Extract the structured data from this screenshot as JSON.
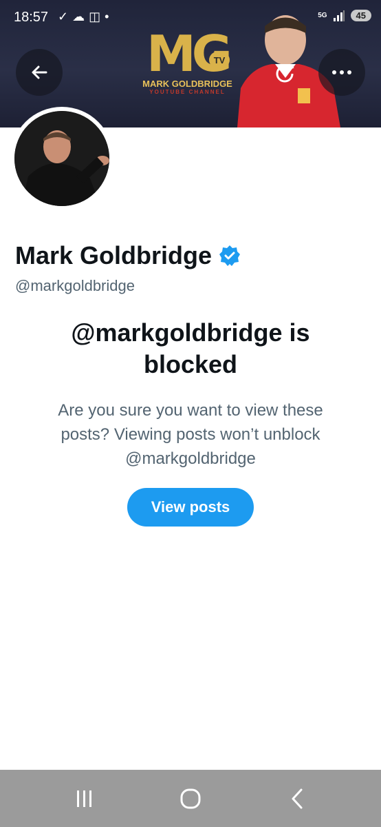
{
  "status_bar": {
    "time": "18:57",
    "network": "5G",
    "battery": "45"
  },
  "banner": {
    "logo_mark": "MG",
    "logo_tv": "TV",
    "logo_name": "MARK GOLDBRIDGE",
    "logo_subtitle": "YOUTUBE CHANNEL"
  },
  "profile": {
    "name": "Mark Goldbridge",
    "handle": "@markgoldbridge",
    "verified_color": "#1d9bf0"
  },
  "blocked": {
    "title": "@markgoldbridge is blocked",
    "description": "Are you sure you want to view these posts? Viewing posts won’t unblock @markgoldbridge",
    "button_label": "View posts"
  },
  "icons": [
    "back-arrow-icon",
    "refresh-icon",
    "more-icon",
    "verified-badge-icon",
    "recent-apps-icon",
    "home-icon",
    "nav-back-icon"
  ],
  "colors": {
    "accent": "#1d9bf0",
    "text_primary": "#0f1419",
    "text_secondary": "#536471"
  }
}
